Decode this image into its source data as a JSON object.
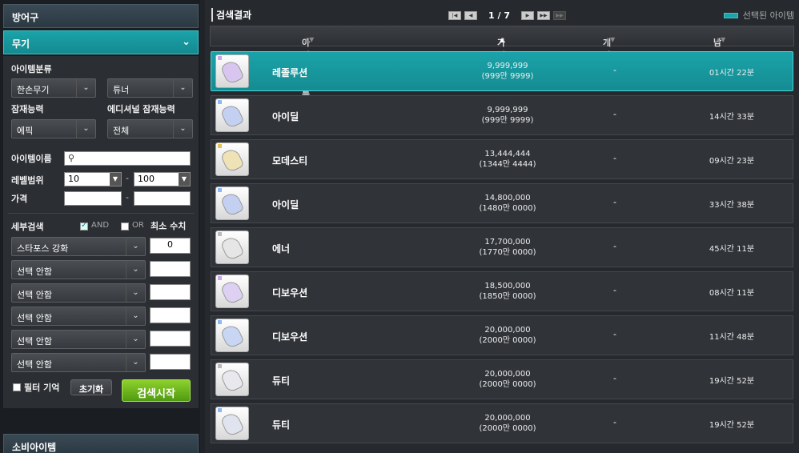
{
  "left": {
    "category_top": "방어구",
    "subcategory": "무기",
    "category_bottom": "소비아이템",
    "item_category_label": "아이템분류",
    "item_category_value": "한손무기",
    "item_subcategory_value": "튜너",
    "potential_label": "잠재능력",
    "potential_value": "에픽",
    "additional_potential_label": "에디셔널 잠재능력",
    "additional_potential_value": "전체",
    "item_name_label": "아이템이름",
    "item_name_value": "",
    "level_range_label": "레벨범위",
    "level_min": "10",
    "level_max": "100",
    "range_sep": "-",
    "price_label": "가격",
    "price_min": "",
    "price_max": "",
    "detail_search_label": "세부검색",
    "and_label": "AND",
    "or_label": "OR",
    "min_value_label": "최소 수치",
    "detail_filters": [
      {
        "option": "스타포스 강화",
        "value": "0"
      },
      {
        "option": "선택 안함",
        "value": ""
      },
      {
        "option": "선택 안함",
        "value": ""
      },
      {
        "option": "선택 안함",
        "value": ""
      },
      {
        "option": "선택 안함",
        "value": ""
      },
      {
        "option": "선택 안함",
        "value": ""
      }
    ],
    "filter_memory_label": "필터 기억",
    "reset_button": "초기화",
    "search_button": "검색시작"
  },
  "right": {
    "title": "검색결과",
    "pagination": "1 / 7",
    "legend": "선택된 아이템",
    "columns": {
      "name": "아이템 이름",
      "price": "가격",
      "unit_price": "개당 가격",
      "time_left": "남은시간"
    },
    "rows": [
      {
        "name": "레졸루션",
        "price": "9,999,999",
        "price_kr": "(999만 9999)",
        "unit": "-",
        "time": "01시간 22분",
        "selected": true,
        "tier": "#c9a7e8",
        "glove": "#d9c6f0"
      },
      {
        "name": "아이딜",
        "price": "9,999,999",
        "price_kr": "(999만 9999)",
        "unit": "-",
        "time": "14시간 33분",
        "selected": false,
        "tier": "#8fb8f0",
        "glove": "#c4d0f2"
      },
      {
        "name": "모데스티",
        "price": "13,444,444",
        "price_kr": "(1344만 4444)",
        "unit": "-",
        "time": "09시간 23분",
        "selected": false,
        "tier": "#e5c25a",
        "glove": "#efe2b6"
      },
      {
        "name": "아이딜",
        "price": "14,800,000",
        "price_kr": "(1480만 0000)",
        "unit": "-",
        "time": "33시간 38분",
        "selected": false,
        "tier": "#8fb8f0",
        "glove": "#c4d0f2"
      },
      {
        "name": "에너",
        "price": "17,700,000",
        "price_kr": "(1770만 0000)",
        "unit": "-",
        "time": "45시간 11분",
        "selected": false,
        "tier": "#bbbbbb",
        "glove": "#e6e6e6"
      },
      {
        "name": "디보우션",
        "price": "18,500,000",
        "price_kr": "(1850만 0000)",
        "unit": "-",
        "time": "08시간 11분",
        "selected": false,
        "tier": "#c9a7e8",
        "glove": "#ddd0f2"
      },
      {
        "name": "디보우션",
        "price": "20,000,000",
        "price_kr": "(2000만 0000)",
        "unit": "-",
        "time": "11시간 48분",
        "selected": false,
        "tier": "#8fb8f0",
        "glove": "#c8d6f4"
      },
      {
        "name": "듀티",
        "price": "20,000,000",
        "price_kr": "(2000만 0000)",
        "unit": "-",
        "time": "19시간 52분",
        "selected": false,
        "tier": "#bbbbbb",
        "glove": "#e8e8ee"
      },
      {
        "name": "듀티",
        "price": "20,000,000",
        "price_kr": "(2000만 0000)",
        "unit": "-",
        "time": "19시간 52분",
        "selected": false,
        "tier": "#8fb8f0",
        "glove": "#e0e4ee"
      }
    ]
  }
}
